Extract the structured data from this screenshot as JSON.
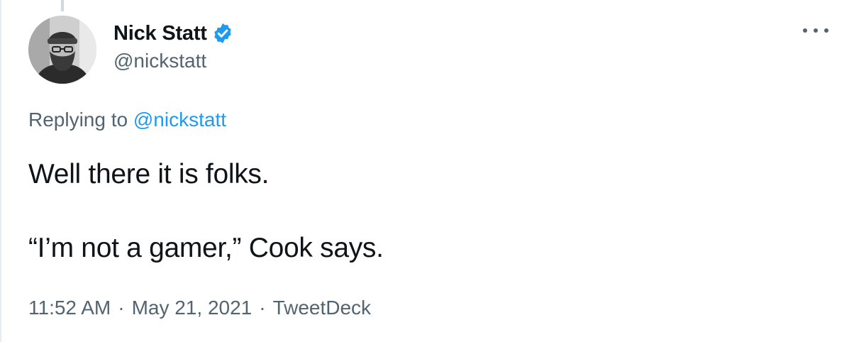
{
  "author": {
    "display_name": "Nick Statt",
    "handle": "@nickstatt",
    "verified": true
  },
  "reply": {
    "prefix": "Replying to",
    "mention": "@nickstatt"
  },
  "tweet": {
    "line1": "Well there it is folks.",
    "line2": "",
    "line3": "“I’m not a gamer,” Cook says."
  },
  "meta": {
    "time": "11:52 AM",
    "date": "May 21, 2021",
    "source": "TweetDeck",
    "separator": "·"
  },
  "colors": {
    "accent": "#1d9bf0",
    "muted": "#536471",
    "text": "#0f1419"
  },
  "icons": {
    "verified": "verified-badge-icon",
    "more": "more-options-icon"
  }
}
